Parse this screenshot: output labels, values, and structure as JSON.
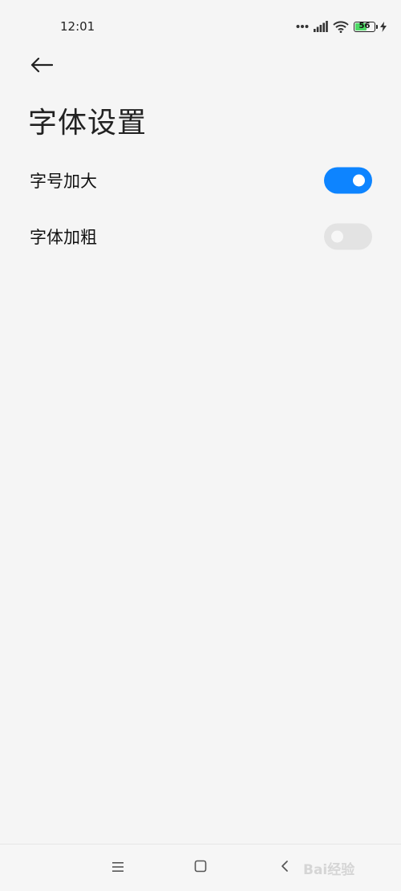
{
  "status_bar": {
    "time": "12:01",
    "battery_level": "56",
    "icons": [
      "more-dots-icon",
      "signal-icon",
      "wifi-icon",
      "battery-icon",
      "charging-icon"
    ]
  },
  "header": {
    "back_icon": "arrow-left-icon",
    "title": "字体设置"
  },
  "settings": [
    {
      "label": "字号加大",
      "enabled": true
    },
    {
      "label": "字体加粗",
      "enabled": false
    }
  ],
  "nav_bar": {
    "icons": [
      "menu-icon",
      "home-icon",
      "back-chevron-icon"
    ]
  },
  "watermark": {
    "text": "Bai经验"
  },
  "colors": {
    "background": "#f5f5f5",
    "toggle_on": "#0d84ff",
    "toggle_off": "#e3e3e3",
    "battery_fill": "#4cd964"
  }
}
